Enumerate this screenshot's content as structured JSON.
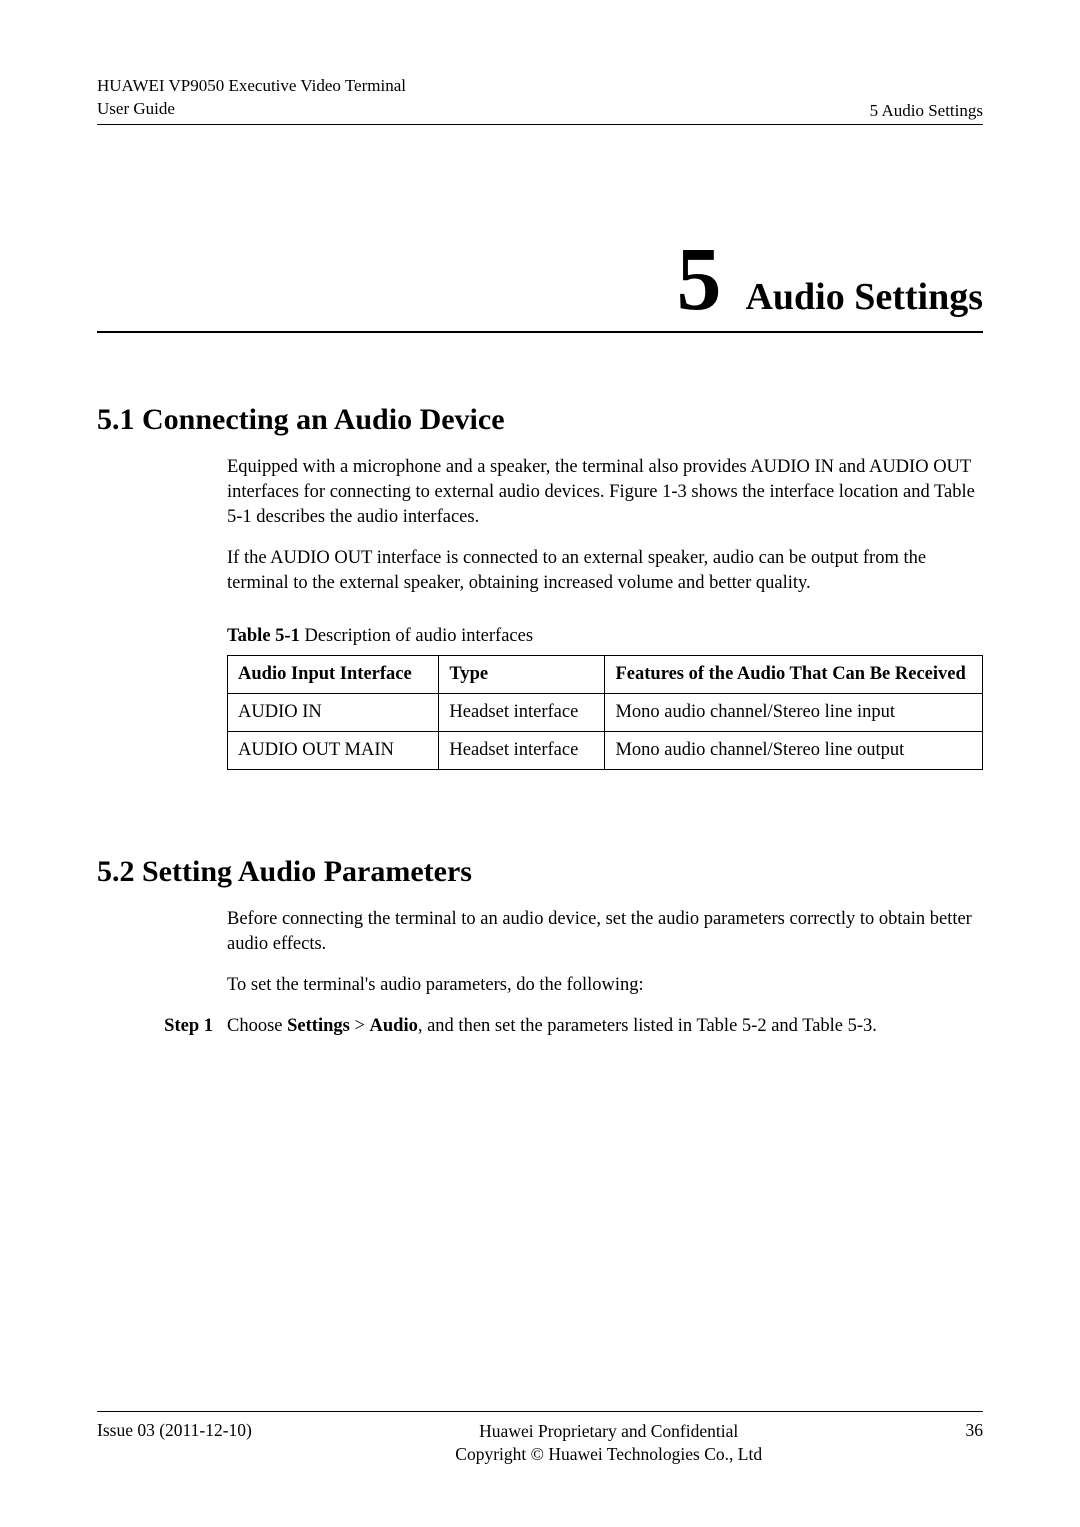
{
  "header": {
    "product_line": "HUAWEI VP9050 Executive Video Terminal",
    "doc_type": "User Guide",
    "section_ref": "5 Audio Settings"
  },
  "chapter": {
    "number": "5",
    "title": "Audio Settings"
  },
  "section_5_1": {
    "heading": "5.1 Connecting an Audio Device",
    "para1": "Equipped with a microphone and a speaker, the terminal also provides AUDIO IN and AUDIO OUT interfaces for connecting to external audio devices. Figure 1-3 shows the interface location and Table 5-1 describes the audio interfaces.",
    "para2": "If the AUDIO OUT interface is connected to an external speaker, audio can be output from the terminal to the external speaker, obtaining increased volume and better quality.",
    "table_caption_bold": "Table 5-1",
    "table_caption_rest": " Description of audio interfaces",
    "table": {
      "headers": {
        "col1": "Audio Input Interface",
        "col2": "Type",
        "col3": "Features of the Audio That Can Be Received"
      },
      "rows": [
        {
          "c1": "AUDIO IN",
          "c2": "Headset interface",
          "c3": "Mono audio channel/Stereo line input"
        },
        {
          "c1": "AUDIO OUT MAIN",
          "c2": "Headset interface",
          "c3": "Mono audio channel/Stereo line output"
        }
      ]
    }
  },
  "section_5_2": {
    "heading": "5.2 Setting Audio Parameters",
    "para1": "Before connecting the terminal to an audio device, set the audio parameters correctly to obtain better audio effects.",
    "para2": "To set the terminal's audio parameters, do the following:",
    "step1_label": "Step 1",
    "step1_pre": "Choose ",
    "step1_bold1": "Settings",
    "step1_sep": " > ",
    "step1_bold2": "Audio",
    "step1_post": ", and then set the parameters listed in Table 5-2 and Table 5-3."
  },
  "footer": {
    "issue": "Issue 03 (2011-12-10)",
    "center1": "Huawei Proprietary and Confidential",
    "center2": "Copyright © Huawei Technologies Co., Ltd",
    "page": "36"
  }
}
